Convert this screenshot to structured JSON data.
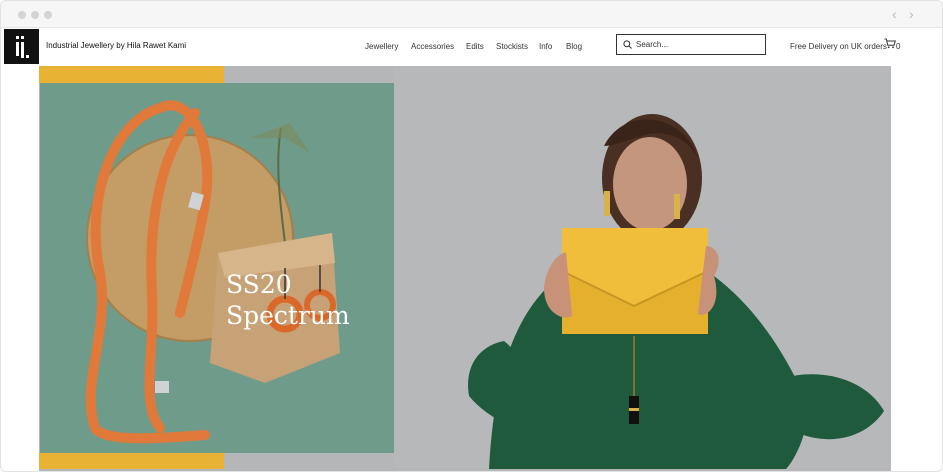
{
  "site": {
    "brand": "Industrial Jewellery by Hila Rawet Kami"
  },
  "nav": {
    "items": [
      "Jewellery",
      "Accessories",
      "Edits",
      "Stockists",
      "Info",
      "Blog"
    ]
  },
  "search": {
    "placeholder": "Search..."
  },
  "header": {
    "delivery": "Free Delivery on UK orders",
    "cart_count": "0"
  },
  "hero": {
    "line1": "SS20",
    "line2": "Spectrum"
  },
  "colors": {
    "accent_yellow": "#e8b234",
    "panel_green": "#6f9b8b",
    "panel_grey": "#b6b8ba",
    "logo_black": "#111111"
  }
}
